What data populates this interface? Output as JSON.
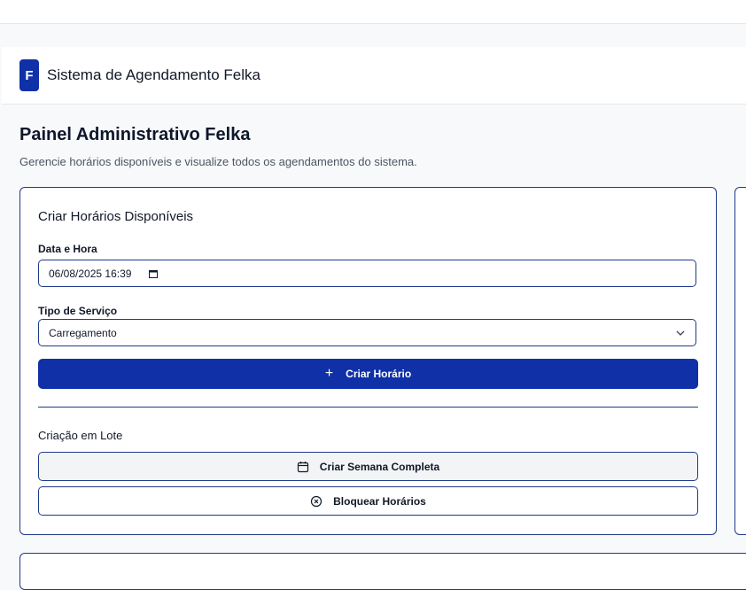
{
  "header": {
    "logo_letter": "F",
    "app_title": "Sistema de Agendamento Felka"
  },
  "page": {
    "title": "Painel Administrativo Felka",
    "subtitle": "Gerencie horários disponíveis e visualize todos os agendamentos do sistema."
  },
  "create_card": {
    "title": "Criar Horários Disponíveis",
    "datetime_label": "Data e Hora",
    "datetime_value": "06/08/2025 16:39",
    "service_label": "Tipo de Serviço",
    "service_value": "Carregamento",
    "create_button": "Criar Horário",
    "batch_title": "Criação em Lote",
    "week_button": "Criar Semana Completa",
    "block_button": "Bloquear Horários"
  },
  "colors": {
    "primary": "#1030a8",
    "border": "#1e3a8a",
    "background": "#f8f9fb"
  },
  "icons": {
    "plus": "plus-icon",
    "calendar": "calendar-icon",
    "block": "x-circle-icon",
    "chevron": "chevron-down-icon"
  }
}
